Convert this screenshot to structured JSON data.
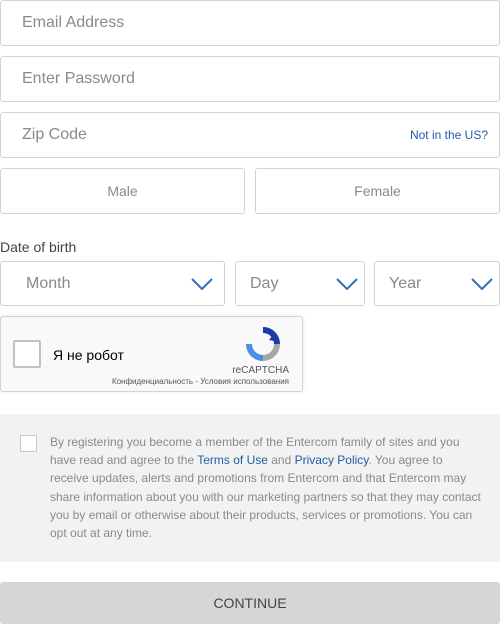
{
  "form": {
    "email_placeholder": "Email Address",
    "password_placeholder": "Enter Password",
    "zip_placeholder": "Zip Code",
    "zip_link": "Not in the US?",
    "gender": {
      "male": "Male",
      "female": "Female"
    },
    "dob": {
      "label": "Date of birth",
      "month": "Month",
      "day": "Day",
      "year": "Year"
    }
  },
  "captcha": {
    "label": "Я не робот",
    "brand": "reCAPTCHA",
    "privacy": "Конфиденциальность",
    "separator": " - ",
    "terms": "Условия использования"
  },
  "terms": {
    "part1": "By registering you become a member of the Entercom family of sites and you have read and agree to the ",
    "terms_link": "Terms of Use",
    "and": " and ",
    "privacy_link": "Privacy Policy",
    "part2": ". You agree to receive updates, alerts and promotions from Entercom and that Entercom may share information about you with our marketing partners so that they may contact you by email or otherwise about their products, services or promotions. You can opt out at any time."
  },
  "continue_label": "CONTINUE",
  "colors": {
    "link": "#1e5fa8",
    "chevron": "#2d72b8",
    "border": "#d4d4d4",
    "button": "#d6d6d6"
  },
  "icons": {
    "chevron": "chevron-down-icon",
    "recaptcha": "recaptcha-logo-icon"
  }
}
